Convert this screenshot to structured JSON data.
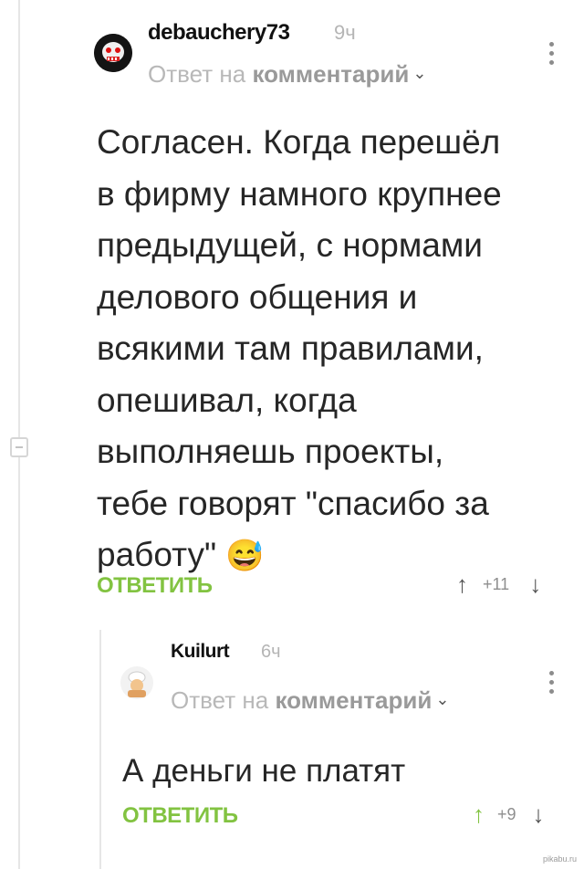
{
  "comments": [
    {
      "username": "debauchery73",
      "time": "9ч",
      "reply_prefix": "Ответ на",
      "reply_target": "комментарий",
      "text_lines": [
        "Согласен. Когда перешёл",
        "в фирму намного крупнее",
        "предыдущей, с нормами",
        "делового общения и",
        "всякими там правилами,",
        "опешивал, когда",
        "выполняешь проекты,",
        "тебе говорят \"спасибо за",
        "работу\""
      ],
      "emoji": "😅",
      "reply_label": "ОТВЕТИТЬ",
      "rating": "+11"
    },
    {
      "username": "Kuilurt",
      "time": "6ч",
      "reply_prefix": "Ответ на",
      "reply_target": "комментарий",
      "text_lines": [
        "А деньги не платят"
      ],
      "reply_label": "ОТВЕТИТЬ",
      "rating": "+9"
    }
  ],
  "icons": {
    "upvote": "↑",
    "downvote": "↓",
    "chevron": "⌄"
  },
  "colors": {
    "accent_green": "#82c341",
    "muted_text": "#b8b8b8"
  },
  "watermark": "pikabu.ru"
}
